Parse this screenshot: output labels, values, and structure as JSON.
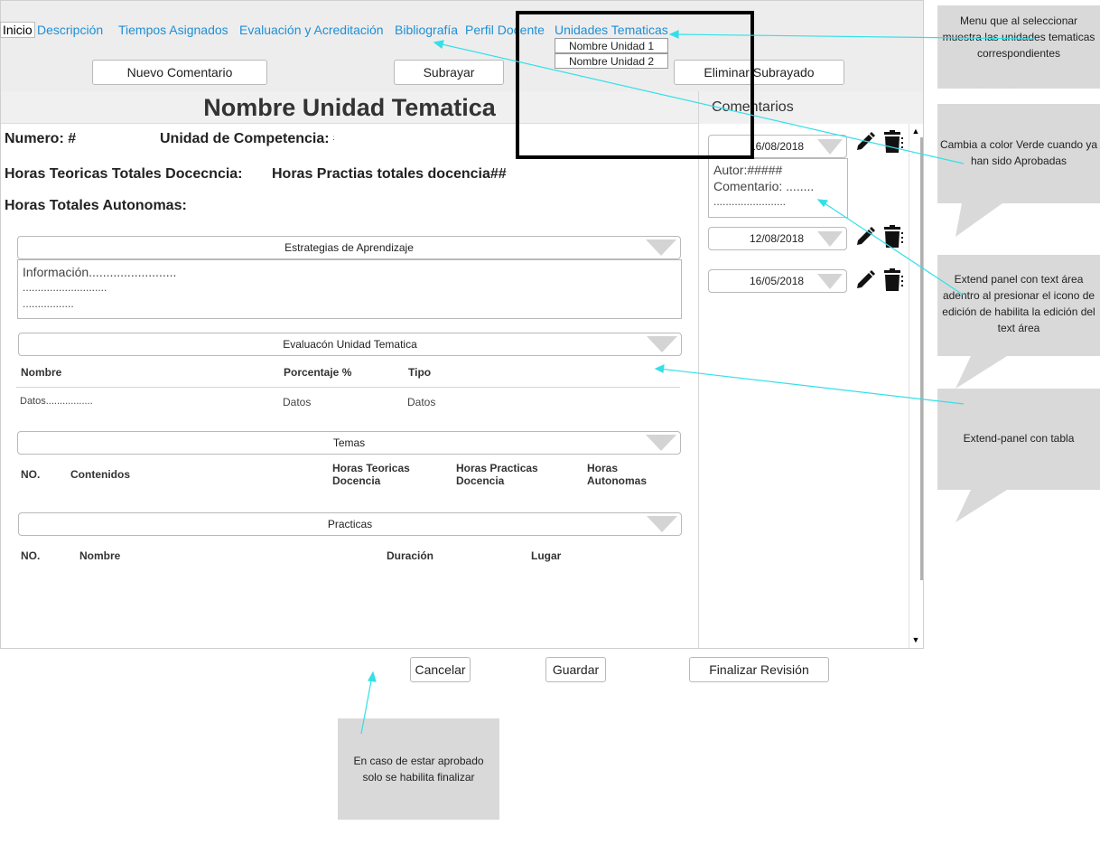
{
  "nav": {
    "items": [
      "Inicio",
      "Descripción",
      "Tiempos Asignados",
      "Evaluación y Acreditación",
      "Bibliografía",
      "Perfil Docente",
      "Unidades Tematicas"
    ],
    "dropdown": [
      "Nombre Unidad 1",
      "Nombre Unidad 2"
    ]
  },
  "toolbar": {
    "new_comment": "Nuevo Comentario",
    "underline": "Subrayar",
    "remove_underline": "Eliminar Subrayado"
  },
  "main": {
    "title": "Nombre Unidad Tematica",
    "numero": "Numero: #",
    "unidad_competencia": "Unidad de Competencia: #",
    "horas_teoricas": "Horas Teoricas Totales Docecncia: #",
    "horas_practicas": "Horas Practias totales docencia##",
    "horas_autonomas": "Horas Totales Autonomas: #"
  },
  "estrategias": {
    "header": "Estrategias de Aprendizaje",
    "lines": [
      "Información.........................",
      "............................",
      "................."
    ]
  },
  "evaluacion": {
    "header": "Evaluacón Unidad Tematica",
    "columns": [
      "Nombre",
      "Porcentaje %",
      "Tipo"
    ],
    "row": [
      "Datos.................",
      "Datos",
      "Datos"
    ]
  },
  "temas": {
    "header": "Temas",
    "columns": [
      "NO.",
      "Contenidos",
      "Horas Teoricas Docencia",
      "Horas Practicas Docencia",
      "Horas Autonomas"
    ]
  },
  "practicas": {
    "header": "Practicas",
    "columns": [
      "NO.",
      "Nombre",
      "Duración",
      "Lugar"
    ]
  },
  "comments": {
    "title": "Comentarios",
    "entries": [
      {
        "date": "16/08/2018",
        "author": "Autor:#####",
        "comment": "Comentario: ........",
        "extra": "........................"
      },
      {
        "date": "12/08/2018"
      },
      {
        "date": "16/05/2018"
      }
    ]
  },
  "footer": {
    "cancel": "Cancelar",
    "save": "Guardar",
    "finish": "Finalizar Revisión"
  },
  "annotations": {
    "menu": "Menu que al seleccionar muestra las unidades tematicas correspondientes",
    "green": "Cambia a color Verde cuando ya han sido Aprobadas",
    "extend_text": "Extend panel con text área adentro al presionar el icono de edición de habilita la edición del text área",
    "extend_table": "Extend-panel con tabla",
    "approved": "En caso de estar aprobado solo se habilita finalizar"
  },
  "colors": {
    "link": "#1f8fd6",
    "connector": "#33e0e8",
    "bubble": "#d9d9d9",
    "panel_bg": "#ededed"
  }
}
